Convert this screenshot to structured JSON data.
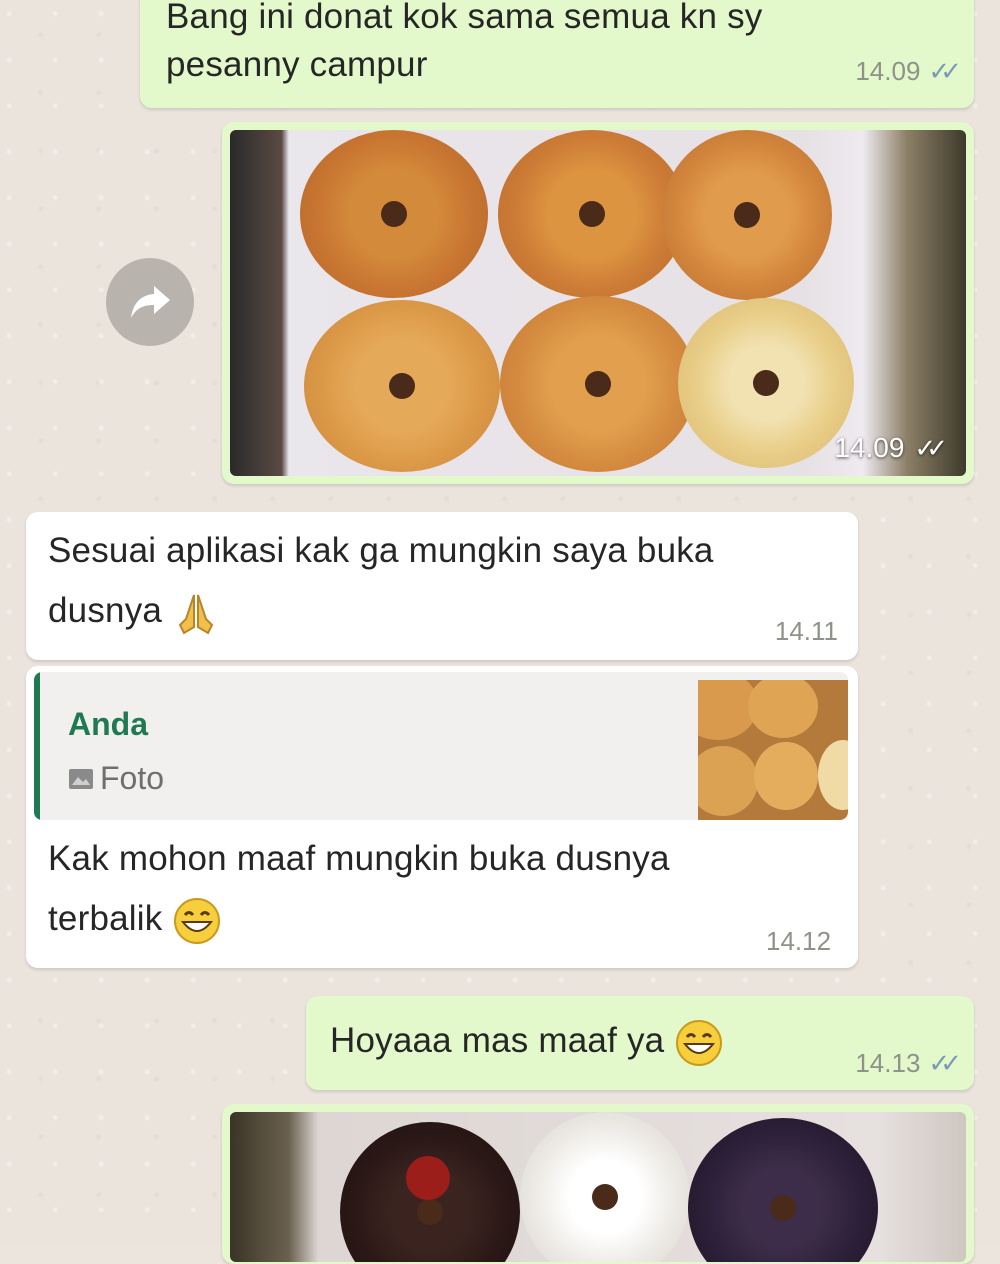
{
  "messages": [
    {
      "id": "m1",
      "direction": "outgoing",
      "lines": [
        "Bang ini donat kok sama semua  kn sy",
        "pesanny campur"
      ],
      "time": "14.09",
      "status": "read-ticks"
    },
    {
      "id": "m2",
      "direction": "outgoing",
      "type": "photo",
      "time": "14.09",
      "status": "read-ticks",
      "forward_icon": "forward-arrow-icon"
    },
    {
      "id": "m3",
      "direction": "incoming",
      "lines": [
        "Sesuai aplikasi kak ga mungkin saya buka",
        "dusnya"
      ],
      "emoji": "folded-hands-icon",
      "time": "14.11"
    },
    {
      "id": "m4",
      "direction": "incoming",
      "reply": {
        "author": "Anda",
        "label": "Foto",
        "icon": "photo-icon",
        "author_color": "#1f7a52"
      },
      "lines": [
        "Kak mohon maaf mungkin buka dusnya",
        "terbalik"
      ],
      "emoji": "grinning-face-icon",
      "time": "14.12"
    },
    {
      "id": "m5",
      "direction": "outgoing",
      "lines": [
        "Hoyaaa mas maaf ya"
      ],
      "emoji": "grinning-face-icon",
      "time": "14.13",
      "status": "read-ticks"
    },
    {
      "id": "m6",
      "direction": "outgoing",
      "type": "photo"
    }
  ],
  "colors": {
    "outgoing_bubble": "#e3f8cb",
    "incoming_bubble": "#ffffff",
    "background": "#ebe4dd",
    "tick": "#7d9ab8"
  }
}
